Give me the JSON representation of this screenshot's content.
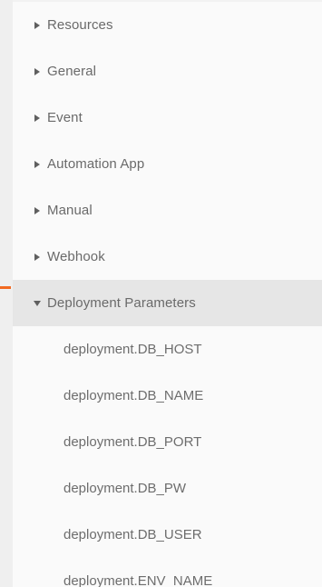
{
  "tree": {
    "items": [
      {
        "label": "Resources",
        "icon": "caret-right-icon"
      },
      {
        "label": "General",
        "icon": "caret-right-icon"
      },
      {
        "label": "Event",
        "icon": "caret-right-icon"
      },
      {
        "label": "Automation App",
        "icon": "caret-right-icon"
      },
      {
        "label": "Manual",
        "icon": "caret-right-icon"
      },
      {
        "label": "Webhook",
        "icon": "caret-right-icon"
      }
    ],
    "expanded": {
      "label": "Deployment Parameters",
      "icon": "caret-down-icon",
      "children": [
        {
          "label": "deployment.DB_HOST"
        },
        {
          "label": "deployment.DB_NAME"
        },
        {
          "label": "deployment.DB_PORT"
        },
        {
          "label": "deployment.DB_PW"
        },
        {
          "label": "deployment.DB_USER"
        },
        {
          "label": "deployment.ENV_NAME"
        }
      ]
    }
  },
  "colors": {
    "accent_marker": "#f26a21",
    "selected_row": "#e6e6e6",
    "text": "#6a6a6a"
  }
}
